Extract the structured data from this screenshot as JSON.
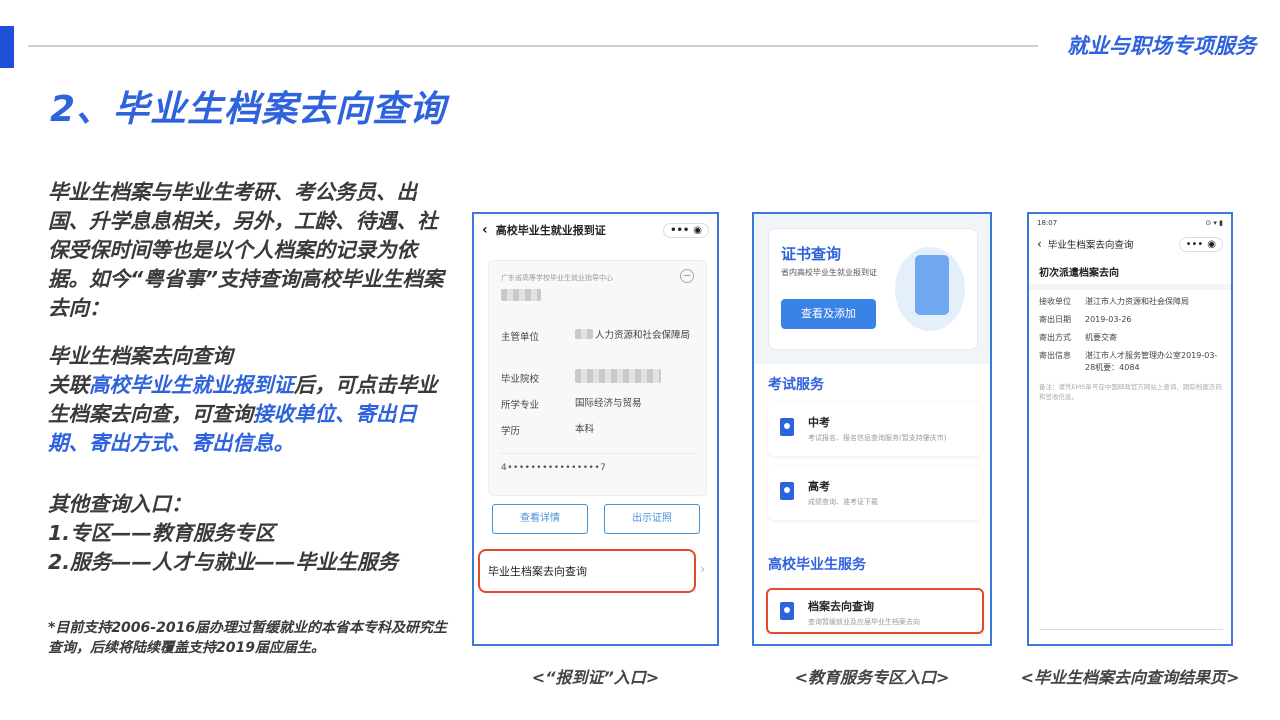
{
  "header": {
    "section_title": "就业与职场专项服务",
    "page_title": "2、毕业生档案去向查询"
  },
  "left": {
    "para1": "毕业生档案与毕业生考研、考公务员、出国、升学息息相关，另外，工龄、待遇、社保受保时间等也是以个人档案的记录为依据。如今“粤省事”支持查询高校毕业生档案去向：",
    "para2_line1": "毕业生档案去向查询",
    "para2_a": "关联",
    "para2_hl1": "高校毕业生就业报到证",
    "para2_b": "后，可点击毕业生档案去向查，可查询",
    "para2_hl2": "接收单位、寄出日期、寄出方式、寄出信息。",
    "para3_line1": "其他查询入口：",
    "para3_line2": "1.专区——教育服务专区",
    "para3_line3": "2.服务——人才与就业——毕业生服务",
    "footnote": "*目前支持2006-2016届办理过暂缓就业的本省本专科及研究生查询，后续将陆续覆盖支持2019届应届生。"
  },
  "phone1": {
    "title": "高校毕业生就业报到证",
    "capsule": "•••",
    "issuer": "广东省高等学校毕业生就业指导中心",
    "rows": [
      {
        "k": "主管单位",
        "v": "人力资源和社会保障局"
      },
      {
        "k": "毕业院校",
        "v": ""
      },
      {
        "k": "所学专业",
        "v": "国际经济与贸易"
      },
      {
        "k": "学历",
        "v": "本科"
      }
    ],
    "id_number": "4••••••••••••••••7",
    "btn_detail": "查看详情",
    "btn_show": "出示证照",
    "highlight_item": "毕业生档案去向查询",
    "caption": "<“报到证”入口>"
  },
  "phone2": {
    "cert_title": "证书查询",
    "cert_sub": "省内高校毕业生就业报到证",
    "cert_btn": "查看及添加",
    "exam_section": "考试服务",
    "exam_items": [
      {
        "title": "中考",
        "sub": "考试报名、报名信息查询服务(暂支持肇庆市)"
      },
      {
        "title": "高考",
        "sub": "成绩查询、准考证下载"
      }
    ],
    "grad_section": "高校毕业生服务",
    "grad_item": {
      "title": "档案去向查询",
      "sub": "查询暂缓就业及应届毕业生档案去向"
    },
    "caption": "<教育服务专区入口>"
  },
  "phone3": {
    "status_time": "18:07",
    "status_right": "⊙ ▾ ▮",
    "title": "毕业生档案去向查询",
    "capsule": "•••",
    "section": "初次派遣档案去向",
    "rows": [
      {
        "k": "接收单位",
        "v": "湛江市人力资源和社会保障局"
      },
      {
        "k": "寄出日期",
        "v": "2019-03-26"
      },
      {
        "k": "寄出方式",
        "v": "机要交寄"
      },
      {
        "k": "寄出信息",
        "v": "湛江市人才服务管理办公室2019-03-28机要：4084"
      }
    ],
    "note": "备注：请凭EMS单号在中国邮政官方网站上查询、跟踪档案去向和签收信息。",
    "caption": "<毕业生档案去向查询结果页>"
  }
}
